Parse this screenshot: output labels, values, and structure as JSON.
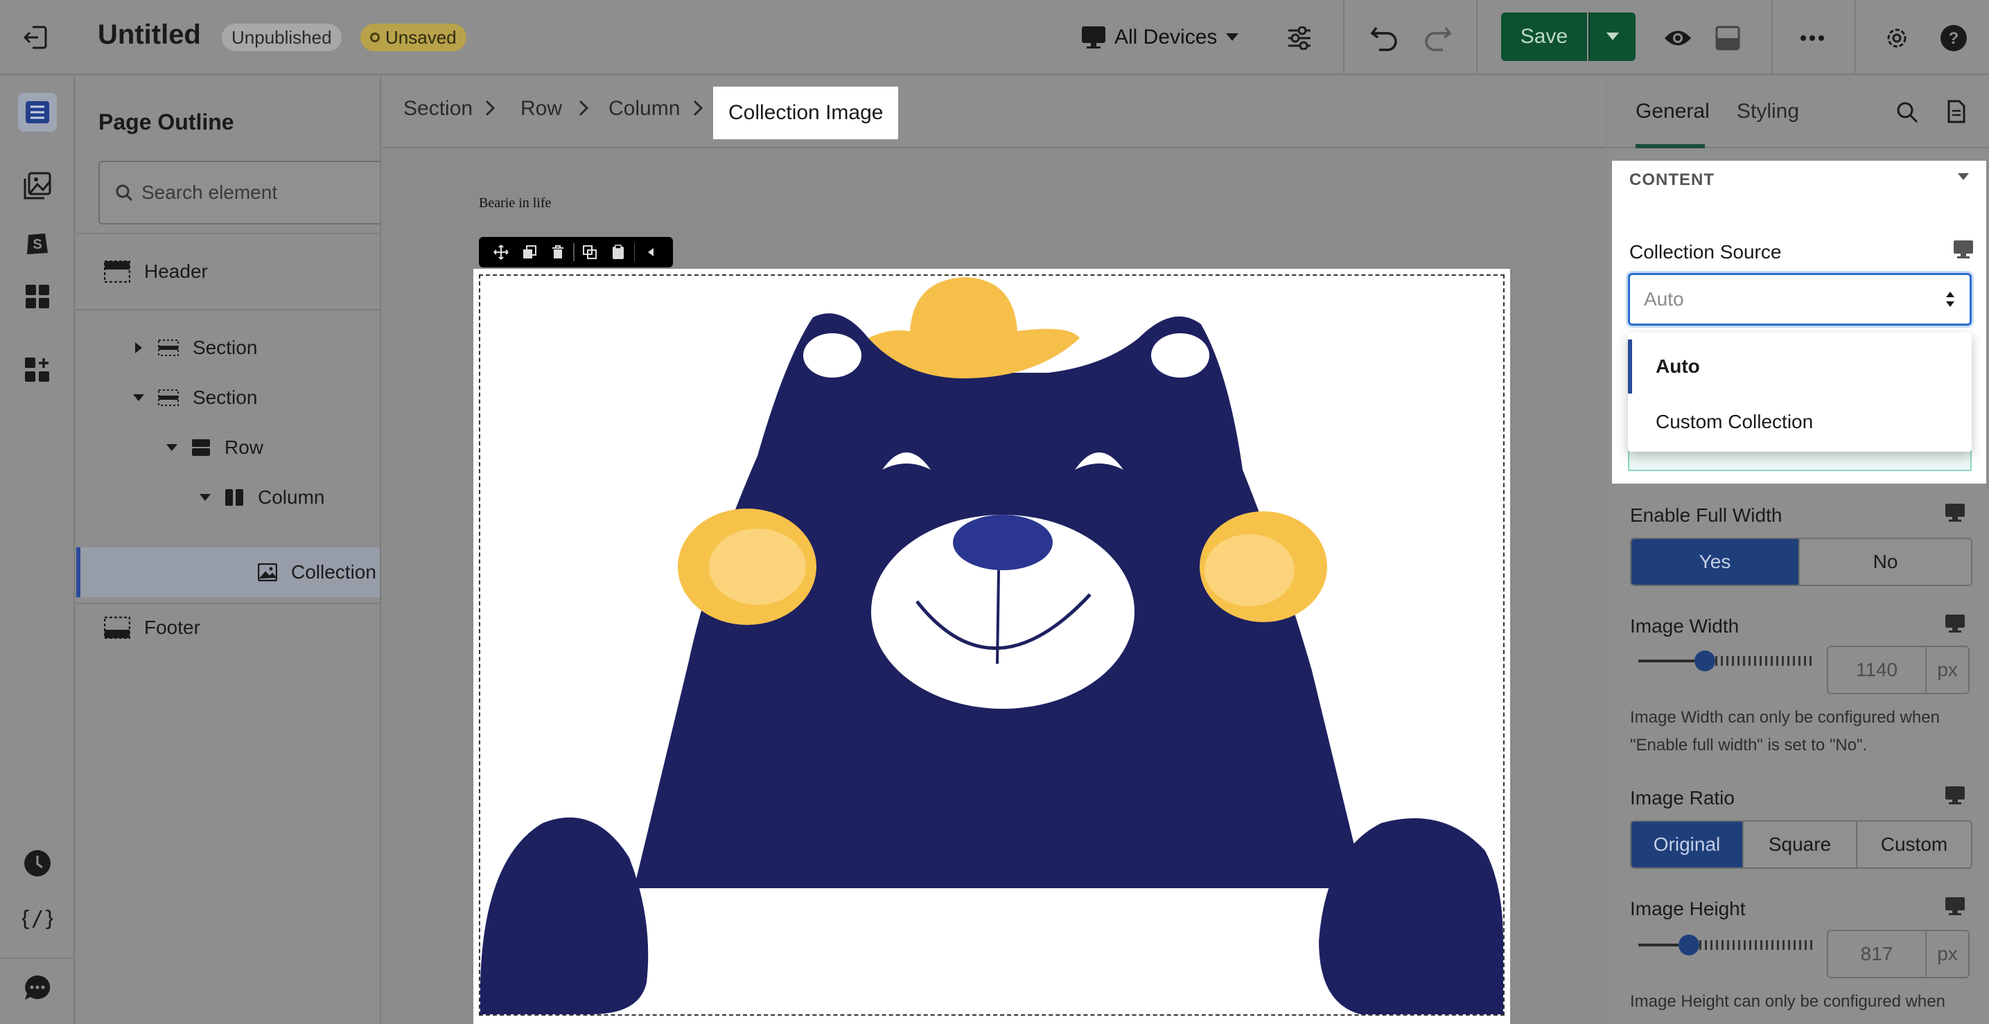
{
  "topbar": {
    "title": "Untitled",
    "badge_unpublished": "Unpublished",
    "badge_unsaved": "Unsaved",
    "device_label": "All Devices",
    "save_label": "Save"
  },
  "outline": {
    "title": "Page Outline",
    "search_placeholder": "Search element",
    "items": {
      "header": "Header",
      "section1": "Section",
      "section2": "Section",
      "row": "Row",
      "column": "Column",
      "collection": "Collection Image",
      "footer": "Footer"
    }
  },
  "breadcrumb": {
    "section": "Section",
    "row": "Row",
    "column": "Column",
    "current": "Collection Image"
  },
  "canvas": {
    "heading_text": "Bearie in life"
  },
  "panel": {
    "tab_general": "General",
    "tab_styling": "Styling",
    "content_heading": "CONTENT",
    "collection_source_label": "Collection Source",
    "collection_source_value": "Auto",
    "collection_source_options": [
      "Auto",
      "Custom Collection"
    ],
    "full_width_label": "Enable Full Width",
    "full_width_options": [
      "Yes",
      "No"
    ],
    "full_width_selected": "Yes",
    "image_width_label": "Image Width",
    "image_width_value": "1140",
    "image_width_fraction": 0.32,
    "image_width_unit": "px",
    "image_width_help": "Image Width can only be configured when \"Enable full width\" is set to \"No\".",
    "image_ratio_label": "Image Ratio",
    "image_ratio_options": [
      "Original",
      "Square",
      "Custom"
    ],
    "image_ratio_selected": "Original",
    "image_height_label": "Image Height",
    "image_height_value": "817",
    "image_height_fraction": 0.23,
    "image_height_unit": "px",
    "image_height_help": "Image Height can only be configured when"
  },
  "colors": {
    "save_green": "#0c5132",
    "accent_blue": "#1f3f7a",
    "select_focus": "#2a6ccf",
    "bear_navy": "#1e2160",
    "bear_yellow": "#f5bf4a"
  }
}
